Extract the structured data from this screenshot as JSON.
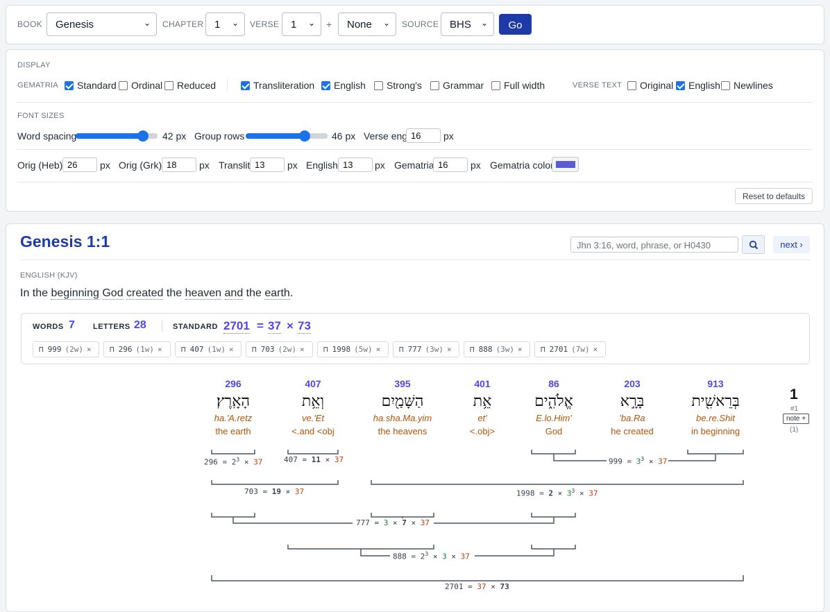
{
  "nav": {
    "book_label": "BOOK",
    "book_value": "Genesis",
    "chapter_label": "CHAPTER",
    "chapter_value": "1",
    "verse_label": "VERSE",
    "verse_value": "1",
    "plus": "+",
    "range_value": "None",
    "source_label": "SOURCE",
    "source_value": "BHS",
    "go_label": "Go"
  },
  "display": {
    "heading": "DISPLAY",
    "gematria_label": "GEMATRIA",
    "gematria_options": [
      {
        "label": "Standard",
        "checked": true
      },
      {
        "label": "Ordinal",
        "checked": false
      },
      {
        "label": "Reduced",
        "checked": false
      }
    ],
    "show_options": [
      {
        "label": "Transliteration",
        "checked": true
      },
      {
        "label": "English",
        "checked": true
      },
      {
        "label": "Strong's",
        "checked": false
      },
      {
        "label": "Grammar",
        "checked": false
      },
      {
        "label": "Full width",
        "checked": false
      }
    ],
    "verse_text_label": "VERSE TEXT",
    "verse_text_options": [
      {
        "label": "Original",
        "checked": false
      },
      {
        "label": "English",
        "checked": true
      },
      {
        "label": "Newlines",
        "checked": false
      }
    ]
  },
  "font_sizes": {
    "heading": "FONT SIZES",
    "word_spacing_label": "Word spacing",
    "word_spacing_value": "42 px",
    "word_spacing_fraction": 0.82,
    "group_rows_label": "Group rows",
    "group_rows_value": "46 px",
    "group_rows_fraction": 0.72,
    "verse_eng_label": "Verse eng",
    "verse_eng_value": "16",
    "px": "px",
    "fields": [
      {
        "label": "Orig (Heb)",
        "value": "26"
      },
      {
        "label": "Orig (Grk)",
        "value": "18"
      },
      {
        "label": "Translit",
        "value": "13"
      },
      {
        "label": "English",
        "value": "13"
      },
      {
        "label": "Gematria",
        "value": "16"
      }
    ],
    "gematria_color_label": "Gematria color",
    "gematria_color": "#5b5bd6",
    "reset_label": "Reset to defaults"
  },
  "verse": {
    "title": "Genesis 1:1",
    "search_placeholder": "Jhn 3:16, word, phrase, or H0430",
    "next_label": "next ›",
    "english_label": "ENGLISH (KJV)",
    "english_segments": [
      {
        "text": "In the ",
        "u": false
      },
      {
        "text": "beginning",
        "u": true
      },
      {
        "text": " ",
        "u": false
      },
      {
        "text": "God",
        "u": true
      },
      {
        "text": " ",
        "u": false
      },
      {
        "text": "created",
        "u": true
      },
      {
        "text": " the ",
        "u": false
      },
      {
        "text": "heaven",
        "u": true
      },
      {
        "text": " ",
        "u": false
      },
      {
        "text": "and",
        "u": true
      },
      {
        "text": " the ",
        "u": false
      },
      {
        "text": "earth",
        "u": true
      },
      {
        "text": ".",
        "u": false
      }
    ],
    "stats": {
      "words_label": "WORDS",
      "words_value": "7",
      "letters_label": "LETTERS",
      "letters_value": "28",
      "standard_label": "STANDARD",
      "standard_value": "2701",
      "eq": "=",
      "factor_a": "37",
      "times": "×",
      "factor_b": "73"
    },
    "chips": [
      {
        "sym": "⊓",
        "num": "999",
        "count": "(2w)"
      },
      {
        "sym": "⊓",
        "num": "296",
        "count": "(1w)"
      },
      {
        "sym": "⊓",
        "num": "407",
        "count": "(1w)"
      },
      {
        "sym": "⊓",
        "num": "703",
        "count": "(2w)"
      },
      {
        "sym": "⊓",
        "num": "1998",
        "count": "(5w)"
      },
      {
        "sym": "⊓",
        "num": "777",
        "count": "(3w)"
      },
      {
        "sym": "⊓",
        "num": "888",
        "count": "(3w)"
      },
      {
        "sym": "⊓",
        "num": "2701",
        "count": "(7w)"
      }
    ],
    "chip_close": "×",
    "words": [
      {
        "value": "296",
        "hebrew": "הָאָֽרֶץ׃",
        "translit": "ha.'A.retz",
        "english": "the earth"
      },
      {
        "value": "407",
        "hebrew": "וְאֵ֥ת",
        "translit": "ve.'Et",
        "english": "<.and <obj"
      },
      {
        "value": "395",
        "hebrew": "הַשָּׁמַ֖יִם",
        "translit": "ha.sha.Ma.yim",
        "english": "the heavens"
      },
      {
        "value": "401",
        "hebrew": "אֵ֥ת",
        "translit": "et'",
        "english": "<.obj>"
      },
      {
        "value": "86",
        "hebrew": "אֱלֹהִ֑ים",
        "translit": "E.lo.Him'",
        "english": "God"
      },
      {
        "value": "203",
        "hebrew": "בָּרָ֣א",
        "translit": "'ba.Ra",
        "english": "he created"
      },
      {
        "value": "913",
        "hebrew": "בְּרֵאשִׁ֖ית",
        "translit": "be.re.Shit",
        "english": "in beginning"
      }
    ],
    "verse_number": "1",
    "verse_index": "#1",
    "note_label": "note +",
    "note_count": "(1)",
    "groups": {
      "g296": {
        "n": "296",
        "eq": "=",
        "b1": "2",
        "e1": "3",
        "x1": "×",
        "c": "37"
      },
      "g407": {
        "n": "407",
        "eq": "=",
        "a": "11",
        "x1": "×",
        "c": "37"
      },
      "g999": {
        "n": "999",
        "eq": "=",
        "b1": "3",
        "e1": "3",
        "x1": "×",
        "c": "37"
      },
      "g703": {
        "n": "703",
        "eq": "=",
        "a": "19",
        "x1": "×",
        "c": "37"
      },
      "g1998": {
        "n": "1998",
        "eq": "=",
        "a": "2",
        "x1": "×",
        "b1": "3",
        "e1": "3",
        "x2": "×",
        "c": "37"
      },
      "g777": {
        "n": "777",
        "eq": "=",
        "a": "3",
        "x1": "×",
        "b": "7",
        "x2": "×",
        "c": "37"
      },
      "g888": {
        "n": "888",
        "eq": "=",
        "b1": "2",
        "e1": "3",
        "x1": "×",
        "a": "3",
        "x2": "×",
        "c": "37"
      },
      "g2701": {
        "n": "2701",
        "eq": "=",
        "c": "37",
        "x1": "×",
        "b": "73"
      }
    }
  }
}
